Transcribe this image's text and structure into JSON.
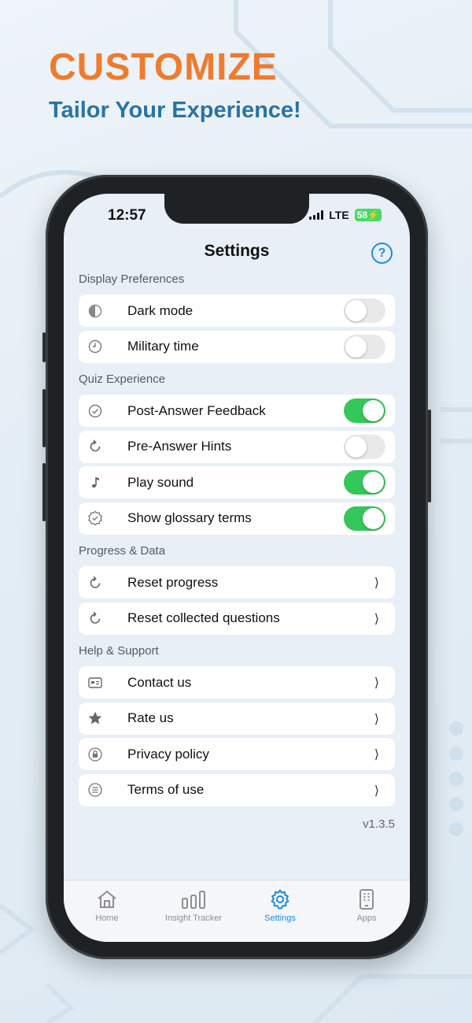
{
  "hero": {
    "title": "CUSTOMIZE",
    "subtitle": "Tailor Your Experience!"
  },
  "status_bar": {
    "time": "12:57",
    "network": "LTE",
    "battery": "58"
  },
  "header": {
    "title": "Settings",
    "help_icon": "question-circle-icon"
  },
  "sections": [
    {
      "label": "Display Preferences",
      "rows": [
        {
          "label": "Dark mode",
          "icon": "half-circle-icon",
          "control": "toggle",
          "on": false
        },
        {
          "label": "Military time",
          "icon": "clock-icon",
          "control": "toggle",
          "on": false
        }
      ]
    },
    {
      "label": "Quiz Experience",
      "rows": [
        {
          "label": "Post-Answer Feedback",
          "icon": "check-circle-icon",
          "control": "toggle",
          "on": true
        },
        {
          "label": "Pre-Answer Hints",
          "icon": "refresh-icon",
          "control": "toggle",
          "on": false
        },
        {
          "label": "Play sound",
          "icon": "music-note-icon",
          "control": "toggle",
          "on": true
        },
        {
          "label": "Show glossary terms",
          "icon": "badge-check-icon",
          "control": "toggle",
          "on": true
        }
      ]
    },
    {
      "label": "Progress & Data",
      "rows": [
        {
          "label": "Reset progress",
          "icon": "reset-icon",
          "control": "chevron"
        },
        {
          "label": "Reset collected questions",
          "icon": "reset-icon",
          "control": "chevron"
        }
      ]
    },
    {
      "label": "Help & Support",
      "rows": [
        {
          "label": "Contact us",
          "icon": "contact-card-icon",
          "control": "chevron"
        },
        {
          "label": "Rate us",
          "icon": "star-icon",
          "control": "chevron"
        },
        {
          "label": "Privacy policy",
          "icon": "lock-icon",
          "control": "chevron"
        },
        {
          "label": "Terms of use",
          "icon": "list-icon",
          "control": "chevron"
        }
      ]
    }
  ],
  "version": "v1.3.5",
  "tabs": [
    {
      "label": "Home",
      "icon": "home-icon",
      "active": false
    },
    {
      "label": "Insight Tracker",
      "icon": "bar-chart-icon",
      "active": false
    },
    {
      "label": "Settings",
      "icon": "gear-icon",
      "active": true
    },
    {
      "label": "Apps",
      "icon": "phone-apps-icon",
      "active": false
    }
  ],
  "colors": {
    "accent": "#1e8be0",
    "hero_title": "#ef7b2e",
    "hero_subtitle": "#2a73a6",
    "toggle_on": "#34c759"
  }
}
